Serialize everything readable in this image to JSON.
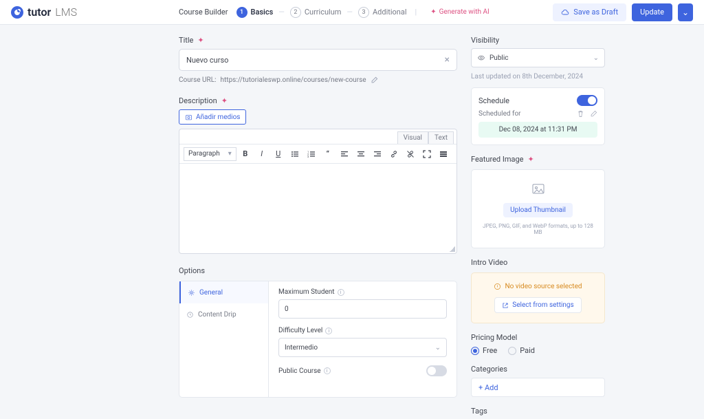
{
  "brand": {
    "name": "tutor",
    "suffix": "LMS"
  },
  "header": {
    "builder": "Course Builder",
    "steps": [
      {
        "n": "1",
        "label": "Basics",
        "active": true
      },
      {
        "n": "2",
        "label": "Curriculum",
        "active": false
      },
      {
        "n": "3",
        "label": "Additional",
        "active": false
      }
    ],
    "gen_ai": "Generate with AI",
    "save_draft": "Save as Draft",
    "update": "Update"
  },
  "title": {
    "label": "Title",
    "value": "Nuevo curso"
  },
  "url": {
    "prefix": "Course URL:",
    "value": "https://tutorialeswp.online/courses/new-course"
  },
  "desc": {
    "label": "Description",
    "media_btn": "Añadir medios",
    "tab_visual": "Visual",
    "tab_text": "Text",
    "format": "Paragraph"
  },
  "options": {
    "label": "Options",
    "nav": {
      "general": "General",
      "drip": "Content Drip"
    },
    "max_student": {
      "label": "Maximum Student",
      "value": "0"
    },
    "difficulty": {
      "label": "Difficulty Level",
      "value": "Intermedio"
    },
    "public_course": "Public Course"
  },
  "side": {
    "visibility": {
      "label": "Visibility",
      "value": "Public"
    },
    "updated": "Last updated on 8th December, 2024",
    "schedule": {
      "label": "Schedule",
      "sub": "Scheduled for",
      "time": "Dec 08, 2024 at 11:31 PM"
    },
    "featured": {
      "label": "Featured Image",
      "upload": "Upload Thumbnail",
      "note": "JPEG, PNG, GIF, and WebP formats, up to 128 MB"
    },
    "intro": {
      "label": "Intro Video",
      "warn": "No video source selected",
      "link": "Select from settings"
    },
    "pricing": {
      "label": "Pricing Model",
      "free": "Free",
      "paid": "Paid"
    },
    "categories": {
      "label": "Categories",
      "add": "+ Add"
    },
    "tags": {
      "label": "Tags"
    }
  }
}
